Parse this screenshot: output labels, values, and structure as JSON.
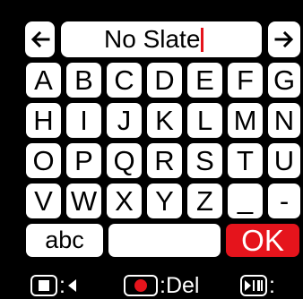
{
  "title_field": {
    "value": "No Slate"
  },
  "nav": {
    "left_arrow_icon": "left-arrow-icon",
    "right_arrow_icon": "right-arrow-icon"
  },
  "keyboard": {
    "rows": [
      [
        "A",
        "B",
        "C",
        "D",
        "E",
        "F",
        "G"
      ],
      [
        "H",
        "I",
        "J",
        "K",
        "L",
        "M",
        "N"
      ],
      [
        "O",
        "P",
        "Q",
        "R",
        "S",
        "T",
        "U"
      ],
      [
        "V",
        "W",
        "X",
        "Y",
        "Z",
        "_",
        "-"
      ]
    ],
    "mode_label": "abc",
    "ok_label": "OK"
  },
  "footer": {
    "del_label": ":Del",
    "colon": ":"
  },
  "colors": {
    "background": "#000000",
    "key": "#ffffff",
    "accent_red": "#e5141c"
  }
}
